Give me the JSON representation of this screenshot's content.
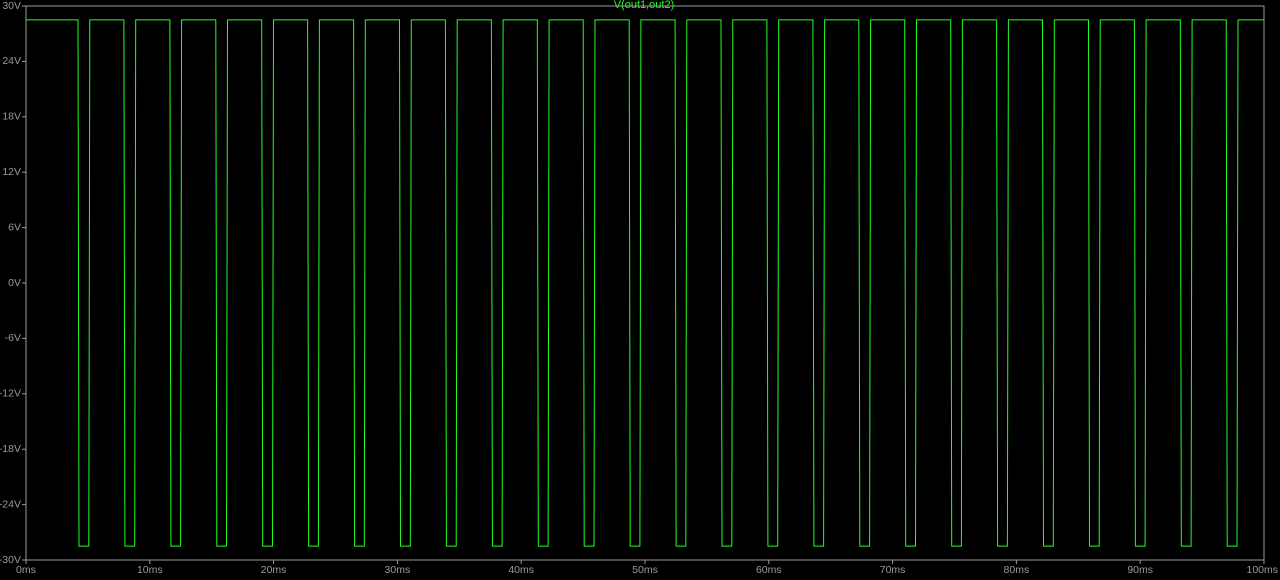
{
  "chart_data": {
    "type": "line",
    "title": "V(out1,out2)",
    "xlabel": "",
    "ylabel": "",
    "xlim": [
      0,
      100
    ],
    "ylim": [
      -30,
      30
    ],
    "x_ticks": [
      "0ms",
      "10ms",
      "20ms",
      "30ms",
      "40ms",
      "50ms",
      "60ms",
      "70ms",
      "80ms",
      "90ms",
      "100ms"
    ],
    "y_ticks": [
      "30V",
      "24V",
      "18V",
      "12V",
      "6V",
      "0V",
      "-6V",
      "-12V",
      "-18V",
      "-24V",
      "-30V"
    ],
    "grid": false,
    "legend": "top-center",
    "colors": {
      "background": "#000000",
      "axis": "#9a9a9a",
      "trace": "#22ff22"
    },
    "series": [
      {
        "name": "V(out1,out2)",
        "high": 28.5,
        "low": -28.5,
        "period_ms": 3.71,
        "first_fall_ms": 4.2,
        "low_duration_ms": 0.95,
        "end_ms": 100
      }
    ]
  }
}
